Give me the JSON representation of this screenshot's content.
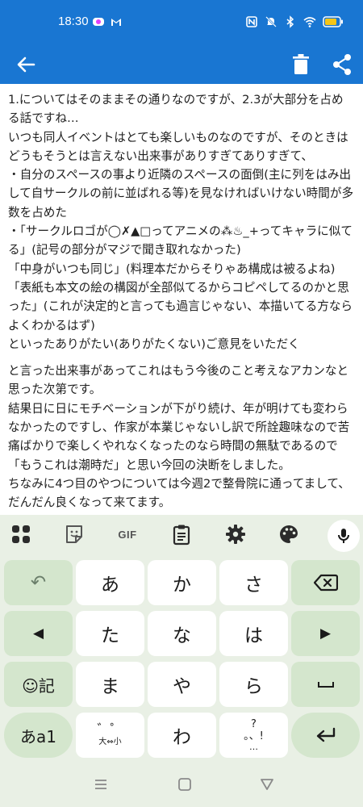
{
  "status_bar": {
    "time": "18:30",
    "left_icons": [
      "app-notification-icon",
      "gmail-icon"
    ],
    "right_icons": [
      "nfc-icon",
      "mute-icon",
      "bluetooth-icon",
      "wifi-icon",
      "battery-icon"
    ]
  },
  "app_bar": {
    "actions": [
      "back-icon",
      "delete-icon",
      "share-icon"
    ],
    "color": "#1976d2"
  },
  "content": {
    "paragraphs": [
      "1.についてはそのままその通りなのですが、2.3が大部分を占める話ですね…\nいつも同人イベントはとても楽しいものなのですが、そのときはどうもそうとは言えない出来事がありすぎてありすぎて、\n・自分のスペースの事より近隣のスペースの面倒(主に列をはみ出して自サークルの前に並ばれる等)を見なければいけない時間が多数を占めた\n・「サークルロゴが◯✗▲□ってアニメの⁂♨_+ってキャラに似てる」(記号の部分がマジで聞き取れなかった)\n「中身がいつも同じ」(料理本だからそりゃあ構成は被るよね)\n「表紙も本文の絵の構図が全部似てるからコピペしてるのかと思った」(これが決定的と言っても過言じゃない、本描いてる方ならよくわかるはず)\nといったありがたい(ありがたくない)ご意見をいただく",
      "と言った出来事があってこれはもう今後のこと考えなアカンなと思った次第です。\n結果日に日にモチベーションが下がり続け、年が明けても変わらなかったのですし、作家が本業じゃないし訳で所詮趣味なので苦痛ばかりで楽しくやれなくなったのなら時間の無駄であるので「もうこれは潮時だ」と思い今回の決断をしました。\nちなみに4つ目のやつについては今週2で整骨院に通ってまして、だんだん良くなって来てます。"
    ]
  },
  "keyboard": {
    "toolbar": {
      "gif_label": "GIF",
      "icons": [
        "apps-grid-icon",
        "sticker-icon",
        "gif-icon",
        "clipboard-icon",
        "settings-gear-icon",
        "theme-palette-icon",
        "microphone-icon"
      ]
    },
    "keys": {
      "undo": "↶",
      "a": "あ",
      "ka": "か",
      "sa": "さ",
      "left": "◀",
      "ta": "た",
      "na": "な",
      "ha": "は",
      "right": "▶",
      "emoji_label": "☺記",
      "ma": "ま",
      "ya": "や",
      "ra": "ら",
      "space": "␣",
      "mode": "あa1",
      "dakuten_top": "゛゜",
      "dakuten_bottom": "大⇔小",
      "wa": "わ",
      "punct_top": "?",
      "punct_bottom": "。、!",
      "punct_dots": "…",
      "enter": "↵"
    }
  },
  "nav_bar": {
    "icons": [
      "recent-apps-icon",
      "home-icon",
      "back-triangle-icon"
    ]
  }
}
